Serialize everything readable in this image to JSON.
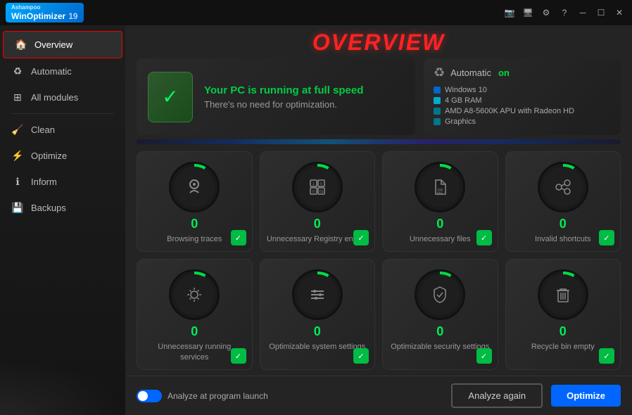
{
  "titlebar": {
    "brand": "Ashampoo",
    "app_name": "WinOptimizer",
    "version": "19",
    "icons": [
      "camera-icon",
      "monitor-icon",
      "gear-icon",
      "help-icon",
      "minimize-icon",
      "maximize-icon",
      "close-icon"
    ]
  },
  "sidebar": {
    "items": [
      {
        "label": "Overview",
        "icon": "🏠",
        "active": true
      },
      {
        "label": "Automatic",
        "icon": "♻",
        "active": false
      },
      {
        "label": "All modules",
        "icon": "⊞",
        "active": false
      },
      {
        "divider": true
      },
      {
        "label": "Clean",
        "icon": "🧹",
        "active": false
      },
      {
        "label": "Optimize",
        "icon": "⚡",
        "active": false
      },
      {
        "label": "Inform",
        "icon": "ℹ",
        "active": false
      },
      {
        "label": "Backups",
        "icon": "💾",
        "active": false
      }
    ]
  },
  "page_title": "OVERVIEW",
  "status": {
    "message1": "Your PC is running at full speed",
    "message2": "There's no need for optimization."
  },
  "system_info": {
    "label": "Automatic",
    "status": "on",
    "specs": [
      {
        "text": "Windows 10",
        "color": "blue"
      },
      {
        "text": "4 GB RAM",
        "color": "cyan"
      },
      {
        "text": "AMD A8-5600K APU with Radeon HD",
        "color": "teal"
      },
      {
        "text": "Graphics",
        "color": "teal"
      }
    ]
  },
  "cards": [
    {
      "label": "Browsing traces",
      "value": "0",
      "icon": "👆"
    },
    {
      "label": "Unnecessary Registry entries",
      "value": "0",
      "icon": "⊞"
    },
    {
      "label": "Unnecessary files",
      "value": "0",
      "icon": "📄"
    },
    {
      "label": "Invalid shortcuts",
      "value": "0",
      "icon": "🔗"
    },
    {
      "label": "Unnecessary running services",
      "value": "0",
      "icon": "⚙"
    },
    {
      "label": "Optimizable system settings",
      "value": "0",
      "icon": "≡"
    },
    {
      "label": "Optimizable security settings",
      "value": "0",
      "icon": "🛡"
    },
    {
      "label": "Recycle bin empty",
      "value": "0",
      "icon": "🗑"
    }
  ],
  "bottom": {
    "toggle_label": "Analyze at program launch",
    "btn_analyze": "Analyze again",
    "btn_optimize": "Optimize"
  }
}
